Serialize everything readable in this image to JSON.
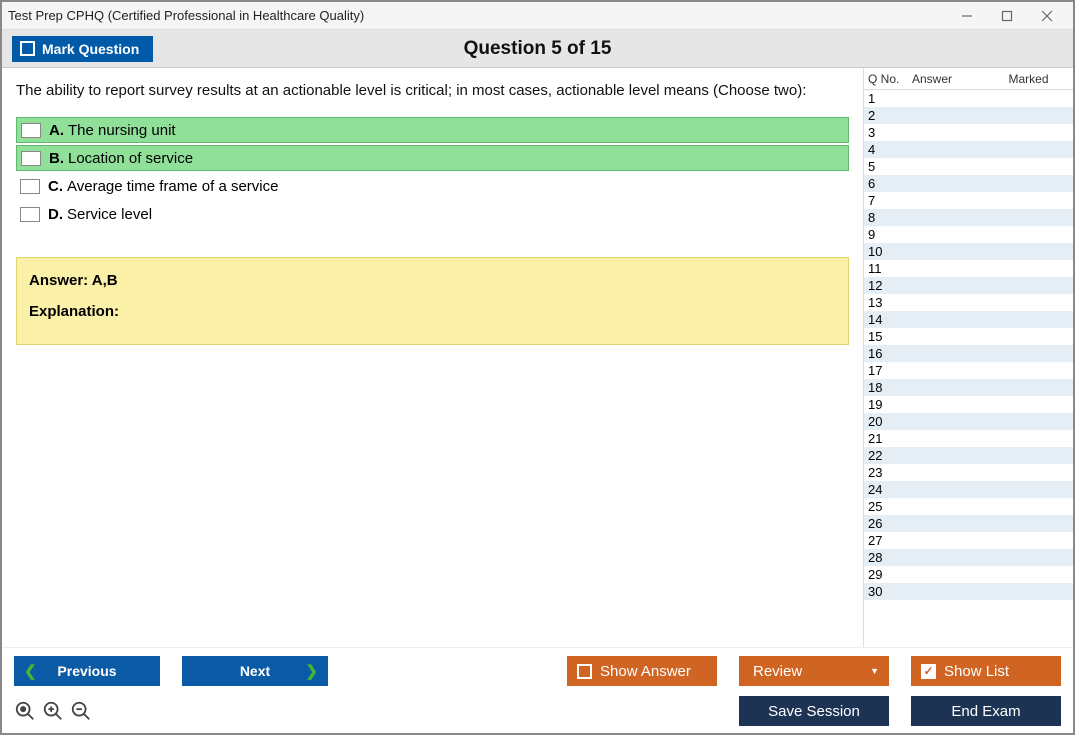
{
  "window": {
    "title": "Test Prep CPHQ (Certified Professional in Healthcare Quality)"
  },
  "header": {
    "mark_label": "Mark Question",
    "title": "Question 5 of 15"
  },
  "question": {
    "prompt": "The ability to report survey results at an actionable level is critical; in most cases, actionable level means (Choose two):",
    "options": [
      {
        "letter": "A.",
        "text": "The nursing unit",
        "highlight": true
      },
      {
        "letter": "B.",
        "text": "Location of service",
        "highlight": true
      },
      {
        "letter": "C.",
        "text": "Average time frame of a service",
        "highlight": false
      },
      {
        "letter": "D.",
        "text": "Service level",
        "highlight": false
      }
    ],
    "answer_label": "Answer: A,B",
    "explanation_label": "Explanation:"
  },
  "sidepanel": {
    "col_qno": "Q No.",
    "col_answer": "Answer",
    "col_marked": "Marked",
    "rows": [
      {
        "n": "1"
      },
      {
        "n": "2"
      },
      {
        "n": "3"
      },
      {
        "n": "4"
      },
      {
        "n": "5"
      },
      {
        "n": "6"
      },
      {
        "n": "7"
      },
      {
        "n": "8"
      },
      {
        "n": "9"
      },
      {
        "n": "10"
      },
      {
        "n": "11"
      },
      {
        "n": "12"
      },
      {
        "n": "13"
      },
      {
        "n": "14"
      },
      {
        "n": "15"
      },
      {
        "n": "16"
      },
      {
        "n": "17"
      },
      {
        "n": "18"
      },
      {
        "n": "19"
      },
      {
        "n": "20"
      },
      {
        "n": "21"
      },
      {
        "n": "22"
      },
      {
        "n": "23"
      },
      {
        "n": "24"
      },
      {
        "n": "25"
      },
      {
        "n": "26"
      },
      {
        "n": "27"
      },
      {
        "n": "28"
      },
      {
        "n": "29"
      },
      {
        "n": "30"
      }
    ]
  },
  "footer": {
    "previous": "Previous",
    "next": "Next",
    "show_answer": "Show Answer",
    "review": "Review",
    "show_list": "Show List",
    "save_session": "Save Session",
    "end_exam": "End Exam"
  }
}
